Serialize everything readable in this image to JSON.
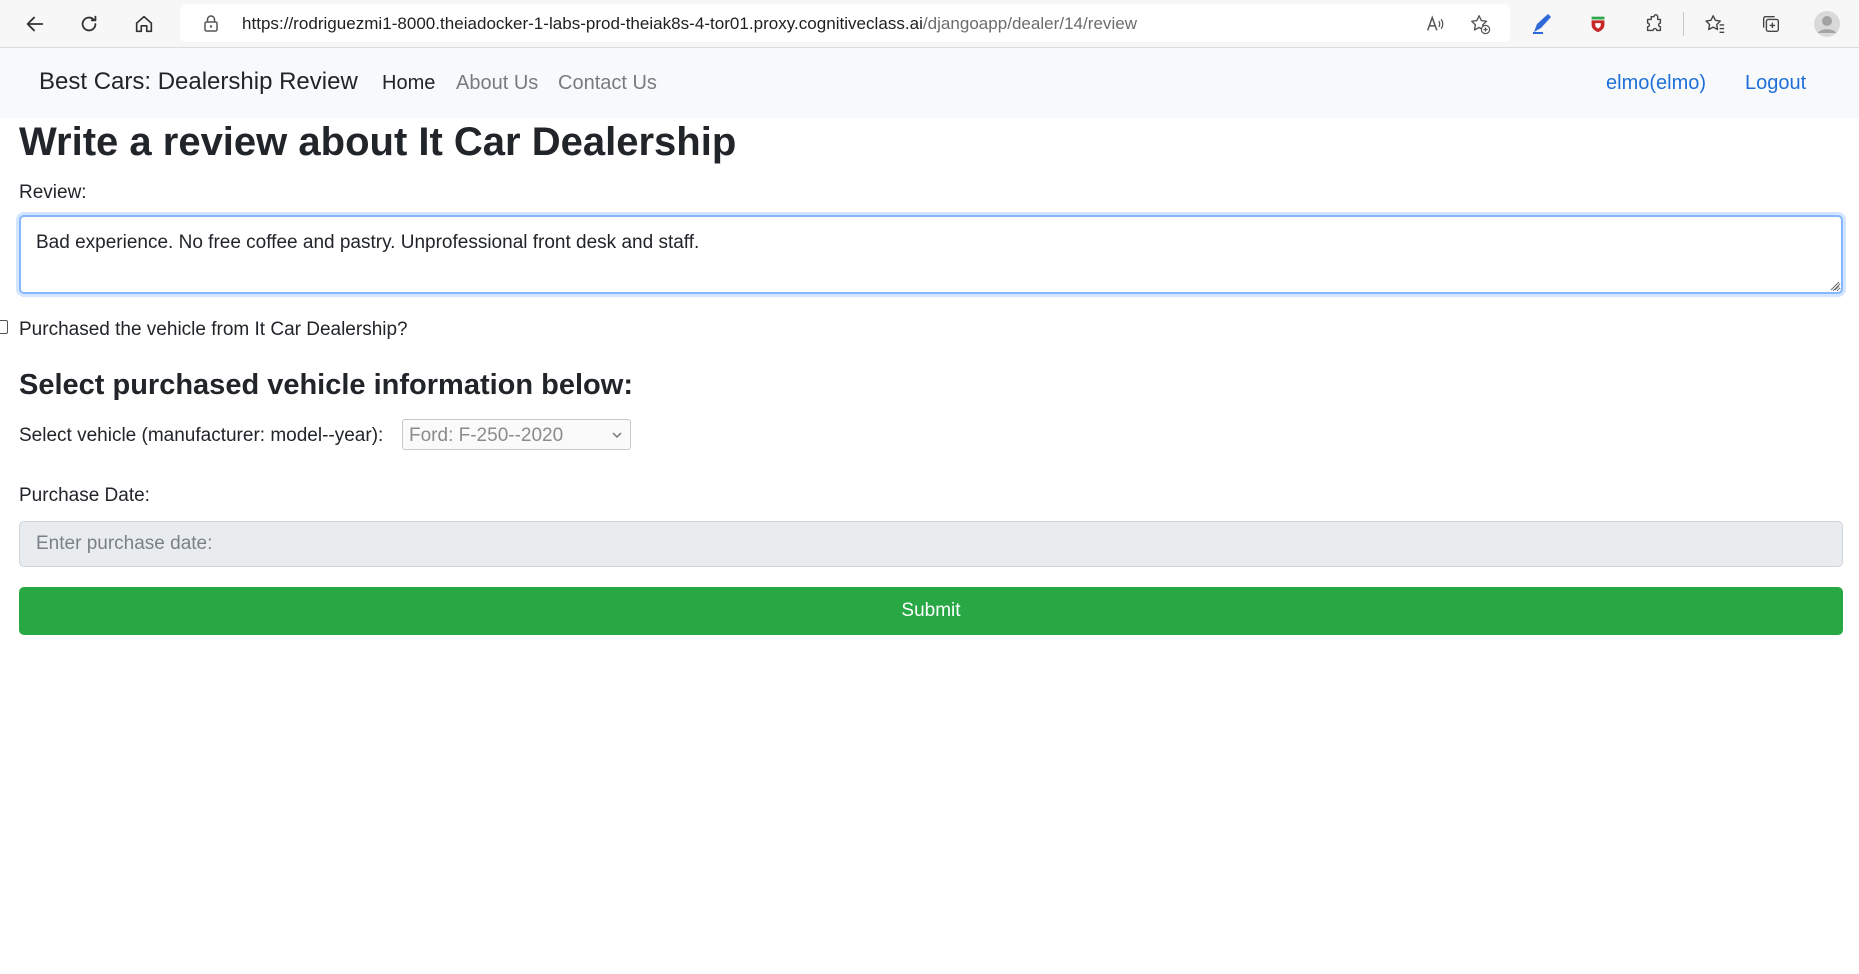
{
  "browser": {
    "url_host": "https://rodriguezmi1-8000.theiadocker-1-labs-prod-theiak8s-4-tor01.proxy.cognitiveclass.ai",
    "url_path": "/djangoapp/dealer/14/review"
  },
  "navbar": {
    "brand": "Best Cars: Dealership Review",
    "links": [
      "Home",
      "About Us",
      "Contact Us"
    ],
    "user": "elmo(elmo)",
    "logout": "Logout"
  },
  "form": {
    "title": "Write a review about It Car Dealership",
    "review_label": "Review:",
    "review_value": "Bad experience. No free coffee and pastry. Unprofessional front desk and staff.",
    "purchase_label": "Purchased the vehicle from It Car Dealership?",
    "purchase_checked": false,
    "section_heading": "Select purchased vehicle information below:",
    "vehicle_label": "Select vehicle (manufacturer: model--year):",
    "vehicle_selected": "Ford: F-250--2020",
    "date_label": "Purchase Date:",
    "date_placeholder": "Enter purchase date:",
    "submit_label": "Submit"
  },
  "colors": {
    "submit": "#28a745",
    "link": "#1f6fd9",
    "navbar_bg": "#f8f9fa"
  }
}
